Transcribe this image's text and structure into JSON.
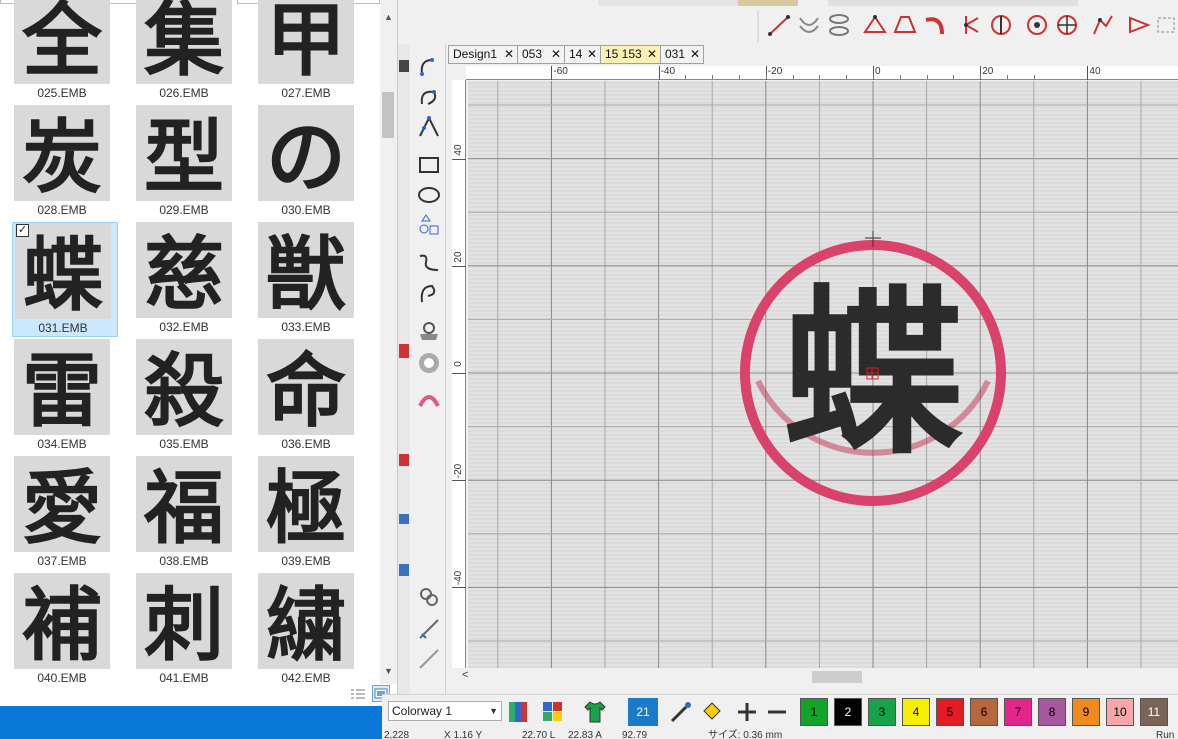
{
  "file_browser": {
    "items": [
      {
        "name": "025.EMB",
        "glyph": "全"
      },
      {
        "name": "026.EMB",
        "glyph": "集"
      },
      {
        "name": "027.EMB",
        "glyph": "甲"
      },
      {
        "name": "028.EMB",
        "glyph": "炭"
      },
      {
        "name": "029.EMB",
        "glyph": "型"
      },
      {
        "name": "030.EMB",
        "glyph": "の"
      },
      {
        "name": "031.EMB",
        "glyph": "蝶",
        "selected": true
      },
      {
        "name": "032.EMB",
        "glyph": "慈"
      },
      {
        "name": "033.EMB",
        "glyph": "獣"
      },
      {
        "name": "034.EMB",
        "glyph": "雷"
      },
      {
        "name": "035.EMB",
        "glyph": "殺"
      },
      {
        "name": "036.EMB",
        "glyph": "命"
      },
      {
        "name": "037.EMB",
        "glyph": "愛"
      },
      {
        "name": "038.EMB",
        "glyph": "福"
      },
      {
        "name": "039.EMB",
        "glyph": "極"
      },
      {
        "name": "040.EMB",
        "glyph": "補"
      },
      {
        "name": "041.EMB",
        "glyph": "刺"
      },
      {
        "name": "042.EMB",
        "glyph": "繍"
      }
    ],
    "checkmark": "✓"
  },
  "tabs": [
    {
      "label": "Design1",
      "close": "✕",
      "active": false
    },
    {
      "label": "053",
      "close": "✕",
      "active": false
    },
    {
      "label": "14",
      "close": "✕",
      "active": false
    },
    {
      "label": "15 153",
      "close": "✕",
      "active": true
    },
    {
      "label": "031",
      "close": "✕",
      "active": false
    }
  ],
  "ruler": {
    "top_labels": [
      "-60",
      "-40",
      "-20",
      "0",
      "20",
      "40"
    ],
    "left_labels": [
      "40",
      "20",
      "0",
      "-20",
      "-40"
    ]
  },
  "design": {
    "glyph": "蝶",
    "ring_color": "#d9426a",
    "thread_color": "#2b2b2b"
  },
  "bottom_bar": {
    "colorway_label": "Colorway 1",
    "color_count": "21",
    "swatches": [
      {
        "num": "1",
        "color": "#12a32a",
        "text": "#000"
      },
      {
        "num": "2",
        "color": "#000000",
        "text": "#fff"
      },
      {
        "num": "3",
        "color": "#16a34a",
        "text": "#000"
      },
      {
        "num": "4",
        "color": "#f6f000",
        "text": "#000"
      },
      {
        "num": "5",
        "color": "#e31b23",
        "text": "#000"
      },
      {
        "num": "6",
        "color": "#b5673d",
        "text": "#000"
      },
      {
        "num": "7",
        "color": "#e4268a",
        "text": "#000"
      },
      {
        "num": "8",
        "color": "#a8589e",
        "text": "#000"
      },
      {
        "num": "9",
        "color": "#f08a1c",
        "text": "#000"
      },
      {
        "num": "10",
        "color": "#f4a8ab",
        "text": "#000"
      },
      {
        "num": "11",
        "color": "#7a6458",
        "text": "#fff"
      }
    ]
  },
  "status": {
    "stitches": "2,228",
    "x": "X    1.16 Y",
    "y": "22.70 L",
    "a": "22.83 A",
    "angle": "92.79",
    "size": "サイズ: 0.36 mm",
    "mode": "Run"
  }
}
